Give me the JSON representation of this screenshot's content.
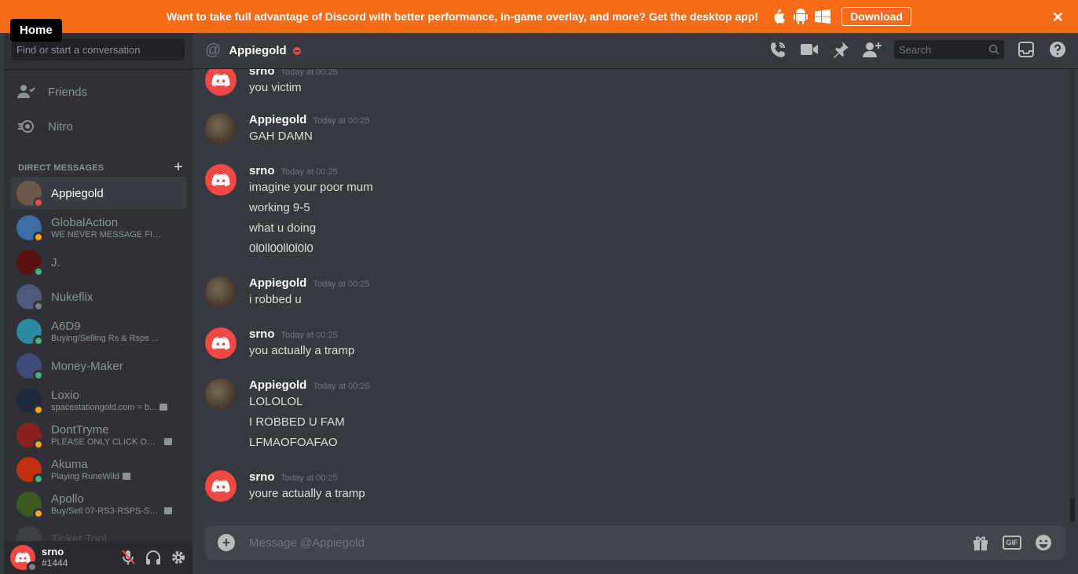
{
  "banner": {
    "message": "Want to take full advantage of Discord with better performance, in-game overlay, and more? Get the desktop app!",
    "download_label": "Download",
    "close": "✕",
    "color": "#f96c17"
  },
  "tooltip": {
    "home": "Home"
  },
  "sidebar": {
    "search_placeholder": "Find or start a conversation",
    "nav": [
      {
        "label": "Friends",
        "icon": "friends-icon"
      },
      {
        "label": "Nitro",
        "icon": "nitro-icon"
      }
    ],
    "dm_header": "DIRECT MESSAGES",
    "dm_add": "+",
    "dms": [
      {
        "name": "Appiegold",
        "sub": "",
        "status": "dnd",
        "active": true
      },
      {
        "name": "GlobalAction",
        "sub": "WE NEVER MESSAGE FIRST",
        "status": "idle"
      },
      {
        "name": "J.",
        "sub": "",
        "status": "online"
      },
      {
        "name": "Nukeflix",
        "sub": "",
        "status": "offline"
      },
      {
        "name": "A6D9",
        "sub": "Buying/Selling Rs & Rsps ...",
        "status": "online"
      },
      {
        "name": "Money-Maker",
        "sub": "",
        "status": "online"
      },
      {
        "name": "Loxio",
        "sub": "spacestationgold.com = b...",
        "status": "idle"
      },
      {
        "name": "DontTryme",
        "sub": "PLEASE ONLY CLICK ON ...",
        "status": "idle"
      },
      {
        "name": "Akuma",
        "sub": "Playing RuneWild",
        "status": "online"
      },
      {
        "name": "Apollo",
        "sub": "Buy/Sell 07-RS3-RSPS-Se...",
        "status": "idle"
      },
      {
        "name": "Ticket Tool",
        "sub": "",
        "status": "online"
      }
    ],
    "user": {
      "name": "srno",
      "tag": "#1444"
    }
  },
  "topbar": {
    "at": "@",
    "title": "Appiegold",
    "search_placeholder": "Search"
  },
  "messages": [
    {
      "author": "srno",
      "time": "Today at 00:25",
      "lines": [
        "you victim"
      ],
      "avatar": "discord"
    },
    {
      "author": "Appiegold",
      "time": "Today at 00:25",
      "lines": [
        "GAH DAMN"
      ],
      "avatar": "photo"
    },
    {
      "author": "srno",
      "time": "Today at 00:25",
      "lines": [
        "imagine your poor mum",
        "working 9-5",
        "what u doing",
        "0l0ll00ll0l0l0"
      ],
      "avatar": "discord"
    },
    {
      "author": "Appiegold",
      "time": "Today at 00:25",
      "lines": [
        "i robbed u"
      ],
      "avatar": "photo"
    },
    {
      "author": "srno",
      "time": "Today at 00:25",
      "lines": [
        "you actually a tramp"
      ],
      "avatar": "discord"
    },
    {
      "author": "Appiegold",
      "time": "Today at 00:25",
      "lines": [
        "LOLOLOL",
        "I ROBBED U FAM",
        "LFMAOFOAFAO"
      ],
      "avatar": "photo"
    },
    {
      "author": "srno",
      "time": "Today at 00:25",
      "lines": [
        "youre actually a tramp"
      ],
      "avatar": "discord"
    }
  ],
  "composer": {
    "placeholder": "Message @Appiegold",
    "gif_label": "GIF"
  },
  "colors": {
    "dnd": "#f04747",
    "idle": "#faa61a",
    "online": "#43b581",
    "offline": "#747f8d"
  }
}
